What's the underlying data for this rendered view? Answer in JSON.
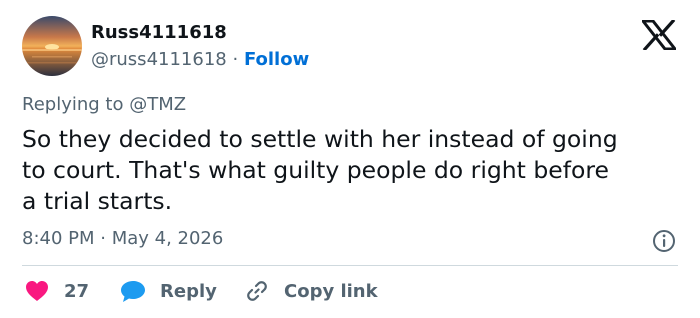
{
  "author": {
    "display_name": "Russ4111618",
    "handle": "@russ4111618",
    "separator": "·",
    "follow_label": "Follow"
  },
  "reply_context": {
    "prefix": "Replying to",
    "mention": "@TMZ"
  },
  "tweet": {
    "text_lines": [
      "So they decided to settle with her instead of going",
      "to court. That's what guilty people do right before",
      "a trial starts."
    ],
    "timestamp": "8:40 PM · May 4, 2026"
  },
  "actions": {
    "like_count": "27",
    "reply_label": "Reply",
    "copy_label": "Copy link"
  },
  "colors": {
    "text_primary": "#0f1419",
    "text_secondary": "#536471",
    "link_blue": "#006fd6",
    "like_pink": "#f91880",
    "reply_blue": "#1d9bf0",
    "divider": "#cfd9de"
  },
  "icons": {
    "brand": "x-logo-icon",
    "info": "info-icon",
    "like": "heart-icon",
    "reply": "speech-bubble-icon",
    "copy": "link-icon"
  }
}
